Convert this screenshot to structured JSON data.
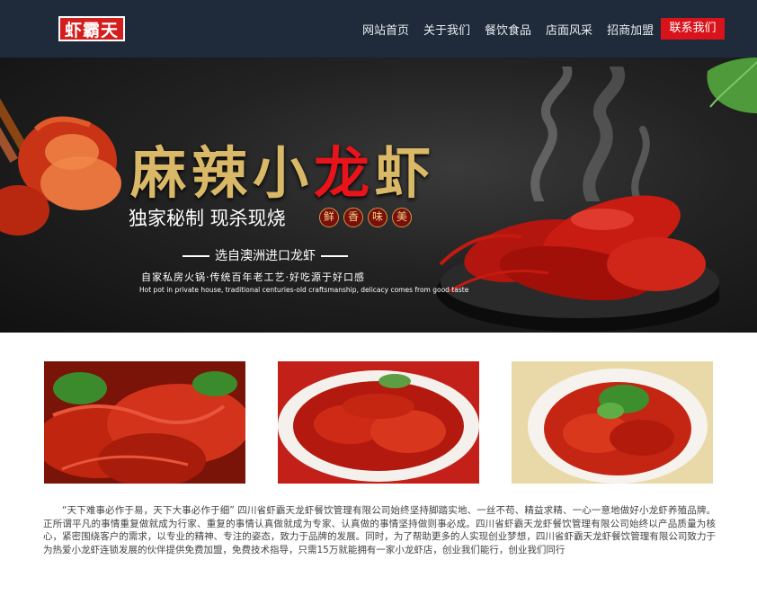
{
  "header": {
    "logo_text": "虾霸天",
    "nav": [
      "网站首页",
      "关于我们",
      "餐饮食品",
      "店面风采",
      "招商加盟"
    ],
    "cta_label": "联系我们"
  },
  "banner": {
    "title_prefix": "麻辣小",
    "title_highlight": "龙",
    "title_suffix": "虾",
    "subtitle": "独家秘制 现杀现烧",
    "seals": [
      "鲜",
      "香",
      "味",
      "美"
    ],
    "import_line": "选自澳洲进口龙虾",
    "tagline_cn": "自家私房火锅·传统百年老工艺·好吃源于好口感",
    "tagline_en": "Hot pot in private house, traditional centuries-old craftsmanship, delicacy comes from good taste"
  },
  "gallery": [
    {
      "icon": "crayfish-pile-photo"
    },
    {
      "icon": "crayfish-plate-photo"
    },
    {
      "icon": "crayfish-cilantro-photo"
    }
  ],
  "intro_text": "“天下难事必作于易，天下大事必作于细” 四川省虾霸天龙虾餐饮管理有限公司始终坚持脚踏实地、一丝不苟、精益求精、一心一意地做好小龙虾养殖品牌。正所谓平凡的事情重复做就成为行家、重复的事情认真做就成为专家、认真做的事情坚持做则事必成。四川省虾霸天龙虾餐饮管理有限公司始终以产品质量为核心，紧密围绕客户的需求，以专业的精神、专注的姿态，致力于品牌的发展。同时，为了帮助更多的人实现创业梦想，四川省虾霸天龙虾餐饮管理有限公司致力于为热爱小龙虾连锁发展的伙伴提供免费加盟，免费技术指导，只需15万就能拥有一家小龙虾店，创业我们能行，创业我们同行",
  "colors": {
    "header_bg": "#1f2a3a",
    "accent_red": "#d8131b",
    "title_gold": "#d9b867"
  }
}
